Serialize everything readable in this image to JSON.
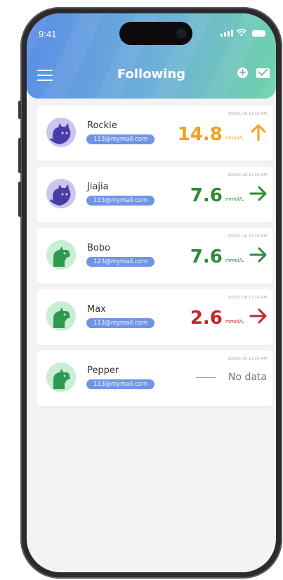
{
  "status_bar": {
    "time": "9:41"
  },
  "header": {
    "title": "Following",
    "menu_icon": "menu-icon",
    "add_icon": "add-icon",
    "mail_icon": "mail-icon"
  },
  "colors": {
    "orange": "#f0a21a",
    "green": "#2e8b3a",
    "red": "#c0272d",
    "email_badge": "#6f95e6",
    "nodata": "#6f7385"
  },
  "followers": [
    {
      "name": "Rockie",
      "email": "113@mymail.com",
      "timestamp": "2023/1/16 12:16 AM",
      "value": "14.8",
      "unit": "mmol/L",
      "trend": "up",
      "color": "#f0a21a",
      "avatar": "cat"
    },
    {
      "name": "Jiajia",
      "email": "113@mymail.com",
      "timestamp": "2023/1/16 12:16 AM",
      "value": "7.6",
      "unit": "mmol/L",
      "trend": "right",
      "color": "#2e8b3a",
      "avatar": "cat"
    },
    {
      "name": "Bobo",
      "email": "123@mymail.com",
      "timestamp": "2023/1/16 15:16 AM",
      "value": "7.6",
      "unit": "mmol/L",
      "trend": "right",
      "color": "#2e8b3a",
      "avatar": "dog"
    },
    {
      "name": "Max",
      "email": "113@mymail.com",
      "timestamp": "2023/1/16 12:16 AM",
      "value": "2.6",
      "unit": "mmol/L",
      "trend": "right",
      "color": "#c0272d",
      "avatar": "dog"
    },
    {
      "name": "Pepper",
      "email": "113@mymail.com",
      "timestamp": "2023/1/16 12:16 AM",
      "value": "",
      "nodata_label": "No data",
      "avatar": "dog"
    }
  ]
}
